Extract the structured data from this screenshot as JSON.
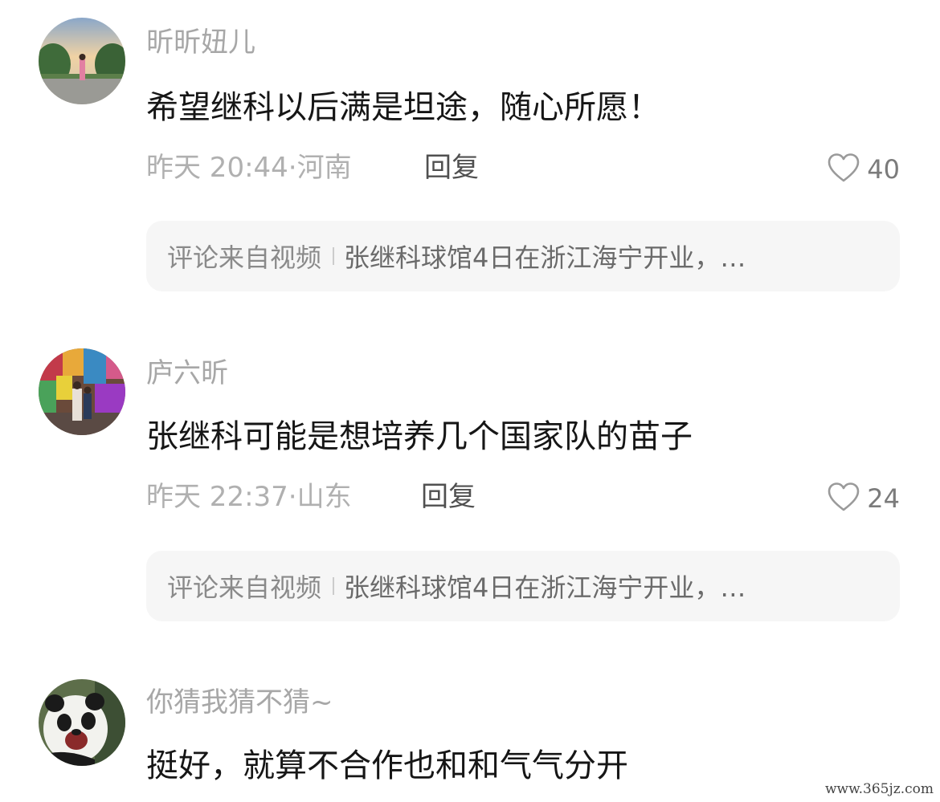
{
  "comments": [
    {
      "username": "昕昕妞儿",
      "text": "希望继科以后满是坦途，随心所愿！",
      "time": "昨天 20:44",
      "separator": "·",
      "location": "河南",
      "reply_label": "回复",
      "likes": "40",
      "source_label": "评论来自视频",
      "source_title": "张继科球馆4日在浙江海宁开业，…"
    },
    {
      "username": "庐六昕",
      "text": "张继科可能是想培养几个国家队的苗子",
      "time": "昨天 22:37",
      "separator": "·",
      "location": "山东",
      "reply_label": "回复",
      "likes": "24",
      "source_label": "评论来自视频",
      "source_title": "张继科球馆4日在浙江海宁开业，…"
    },
    {
      "username": "你猜我猜不猜~",
      "text": "挺好，就算不合作也和和气气分开"
    }
  ],
  "icons": {
    "like": "heart-outline-icon"
  },
  "watermark": "www.365jz.com",
  "colors": {
    "username": "#a7a7a7",
    "meta": "#b0b0b0",
    "source_bg": "#f6f6f6"
  }
}
